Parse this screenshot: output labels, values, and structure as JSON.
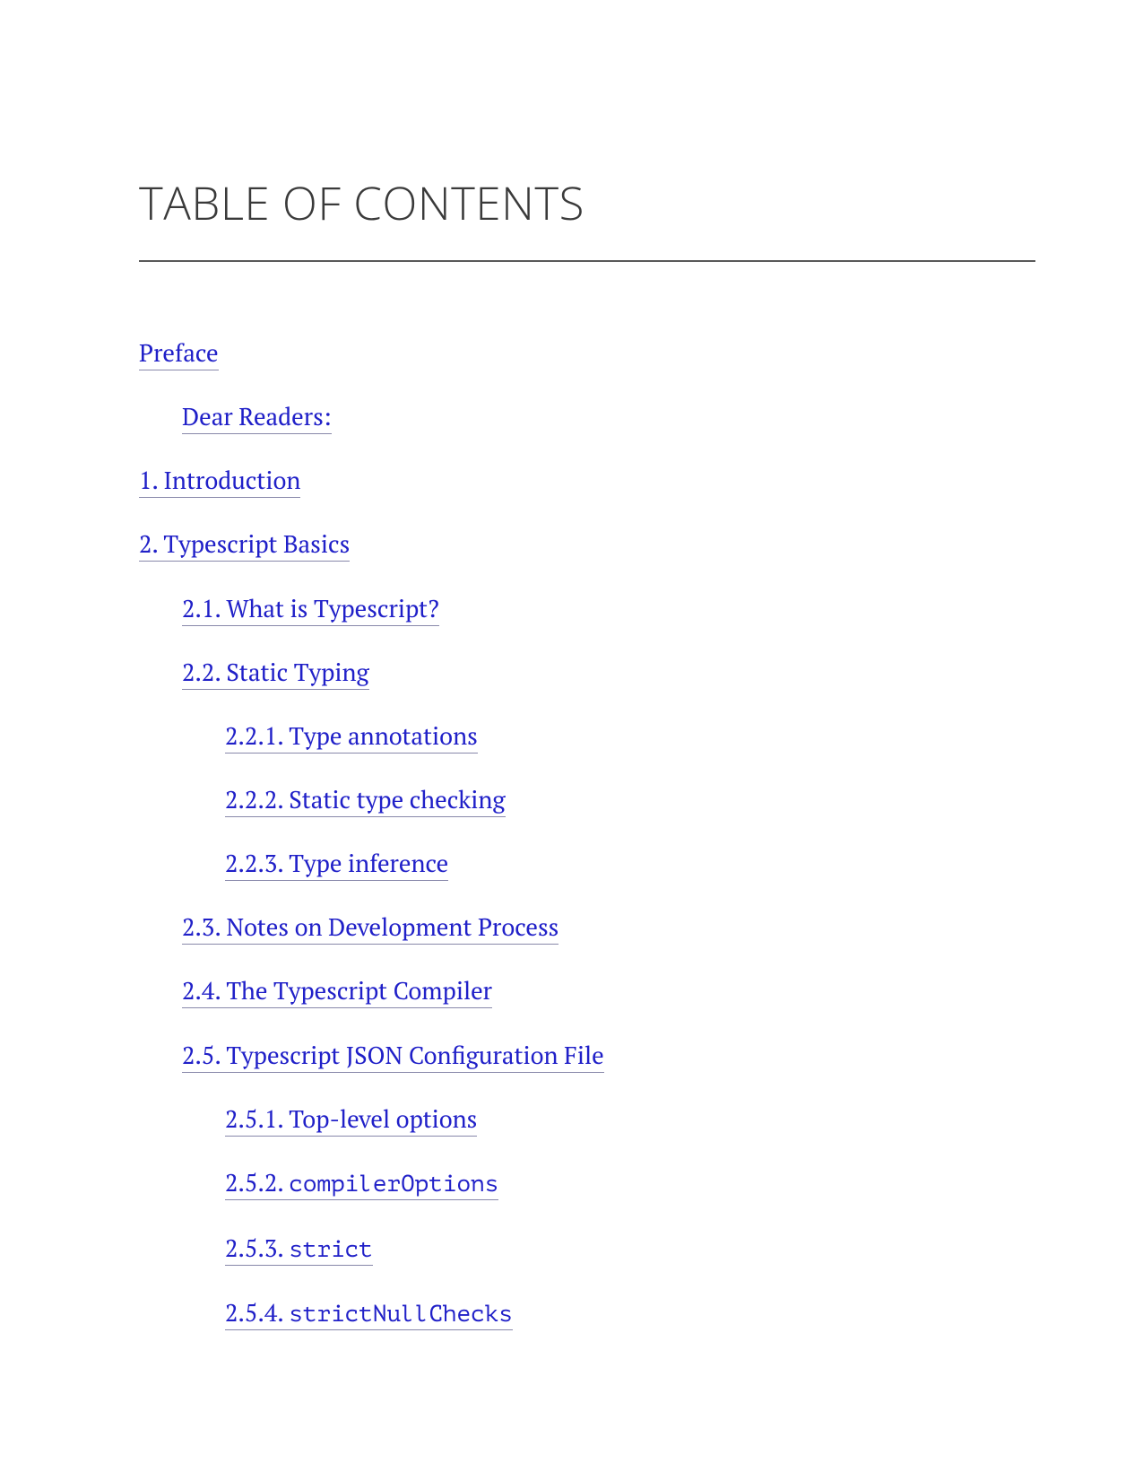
{
  "title": "TABLE OF CONTENTS",
  "toc": [
    {
      "level": 0,
      "label": "Preface",
      "mono": false
    },
    {
      "level": 1,
      "label": "Dear Readers:",
      "mono": false
    },
    {
      "level": 0,
      "label": "1. Introduction",
      "mono": false
    },
    {
      "level": 0,
      "label": "2. Typescript Basics",
      "mono": false
    },
    {
      "level": 1,
      "label": "2.1. What is Typescript?",
      "mono": false
    },
    {
      "level": 1,
      "label": "2.2. Static Typing",
      "mono": false
    },
    {
      "level": 2,
      "label": "2.2.1. Type annotations",
      "mono": false
    },
    {
      "level": 2,
      "label": "2.2.2. Static type checking",
      "mono": false
    },
    {
      "level": 2,
      "label": "2.2.3. Type inference",
      "mono": false
    },
    {
      "level": 1,
      "label": "2.3. Notes on Development Process",
      "mono": false
    },
    {
      "level": 1,
      "label": "2.4. The Typescript Compiler",
      "mono": false
    },
    {
      "level": 1,
      "label": "2.5. Typescript JSON Configuration File",
      "mono": false
    },
    {
      "level": 2,
      "label": "2.5.1. Top-level options",
      "mono": false
    },
    {
      "level": 2,
      "label_prefix": "2.5.2. ",
      "label_mono": "compilerOptions",
      "mono": true
    },
    {
      "level": 2,
      "label_prefix": "2.5.3. ",
      "label_mono": "strict",
      "mono": true
    },
    {
      "level": 2,
      "label_prefix": "2.5.4. ",
      "label_mono": "strictNullChecks",
      "mono": true
    }
  ]
}
